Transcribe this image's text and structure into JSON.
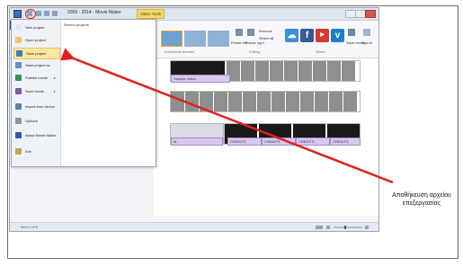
{
  "window": {
    "title": "2009 - 2014 - Movie Maker",
    "tools_tab": "Video Tools"
  },
  "file_menu": {
    "recent_header": "Recent projects",
    "items": [
      {
        "label": "New project",
        "icon": "new-project-icon",
        "color": "#dfe6f0"
      },
      {
        "label": "Open project",
        "icon": "open-project-icon",
        "color": "#e9c46a"
      },
      {
        "label": "Save project",
        "icon": "save-project-icon",
        "color": "#4a78b8",
        "highlighted": true
      },
      {
        "label": "Save project as",
        "icon": "save-project-as-icon",
        "color": "#6a8fc4"
      },
      {
        "label": "Publish movie",
        "icon": "publish-movie-icon",
        "color": "#3a8f5a",
        "submenu": true
      },
      {
        "label": "Save movie",
        "icon": "save-movie-icon",
        "color": "#7a5aa8",
        "submenu": true
      },
      {
        "label": "Import from device",
        "icon": "import-device-icon",
        "color": "#5a7fa6"
      },
      {
        "label": "Options",
        "icon": "options-icon",
        "color": "#8c96a3"
      },
      {
        "label": "About Movie Maker",
        "icon": "about-icon",
        "color": "#2b5fa8"
      },
      {
        "label": "Exit",
        "icon": "exit-icon",
        "color": "#c9a44a"
      }
    ]
  },
  "ribbon": {
    "group_easy_themes": "AutoMovie themes",
    "group_editing": "Editing",
    "group_share": "Share",
    "btn_rotate_left": "Rotate left",
    "btn_rotate_right": "Rotate right",
    "btn_remove": "Remove",
    "btn_select_all": "Select all",
    "btn_save_movie": "Save movie",
    "btn_sign_in": "Sign in"
  },
  "storyboard": {
    "captions": [
      "Sample Video",
      "M...",
      "CREDITS",
      "CREDITS",
      "CREDITS",
      "CREDITS"
    ]
  },
  "status": {
    "text": "Item 1 of 6"
  },
  "annotation": {
    "text": "Αποθήκευση αρχείου επεξεργασίας",
    "arrow_color": "#e02020"
  }
}
